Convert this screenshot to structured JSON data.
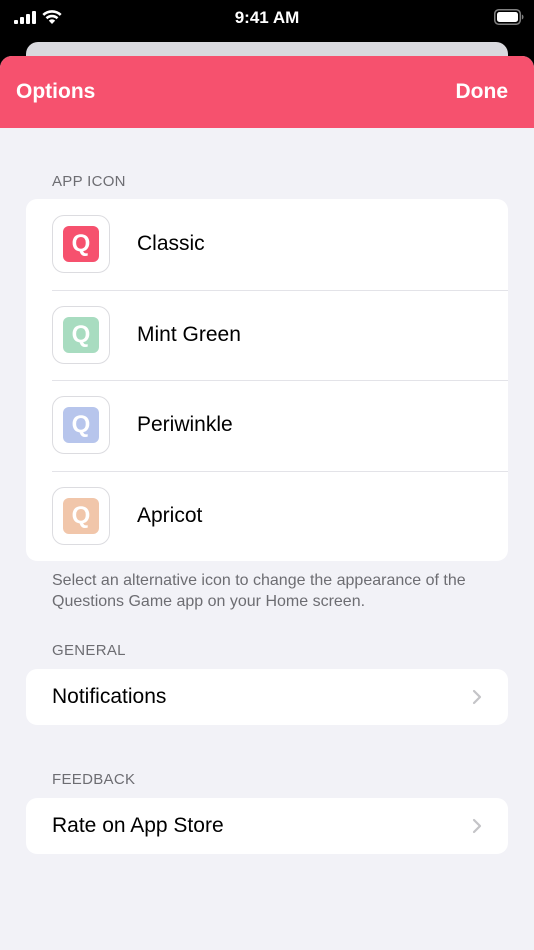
{
  "status_bar": {
    "time": "9:41 AM"
  },
  "nav": {
    "title": "Options",
    "done_label": "Done"
  },
  "app_icon_section": {
    "header": "APP ICON",
    "icon_letter": "Q",
    "items": [
      {
        "label": "Classic",
        "color": "#f6516e"
      },
      {
        "label": "Mint Green",
        "color": "#a8dcc0"
      },
      {
        "label": "Periwinkle",
        "color": "#b7c5ec"
      },
      {
        "label": "Apricot",
        "color": "#f1c6aa"
      }
    ],
    "footer": "Select an alternative icon to change the appearance of the Questions Game app on your Home screen."
  },
  "general_section": {
    "header": "GENERAL",
    "items": [
      {
        "label": "Notifications",
        "icon": "chevron-right-icon"
      }
    ]
  },
  "feedback_section": {
    "header": "FEEDBACK",
    "items": [
      {
        "label": "Rate on App Store",
        "icon": "chevron-right-icon"
      }
    ]
  },
  "colors": {
    "accent": "#f6516e",
    "background": "#f2f2f7",
    "secondary_text": "#6d6d72",
    "chevron": "#c4c4c7"
  }
}
